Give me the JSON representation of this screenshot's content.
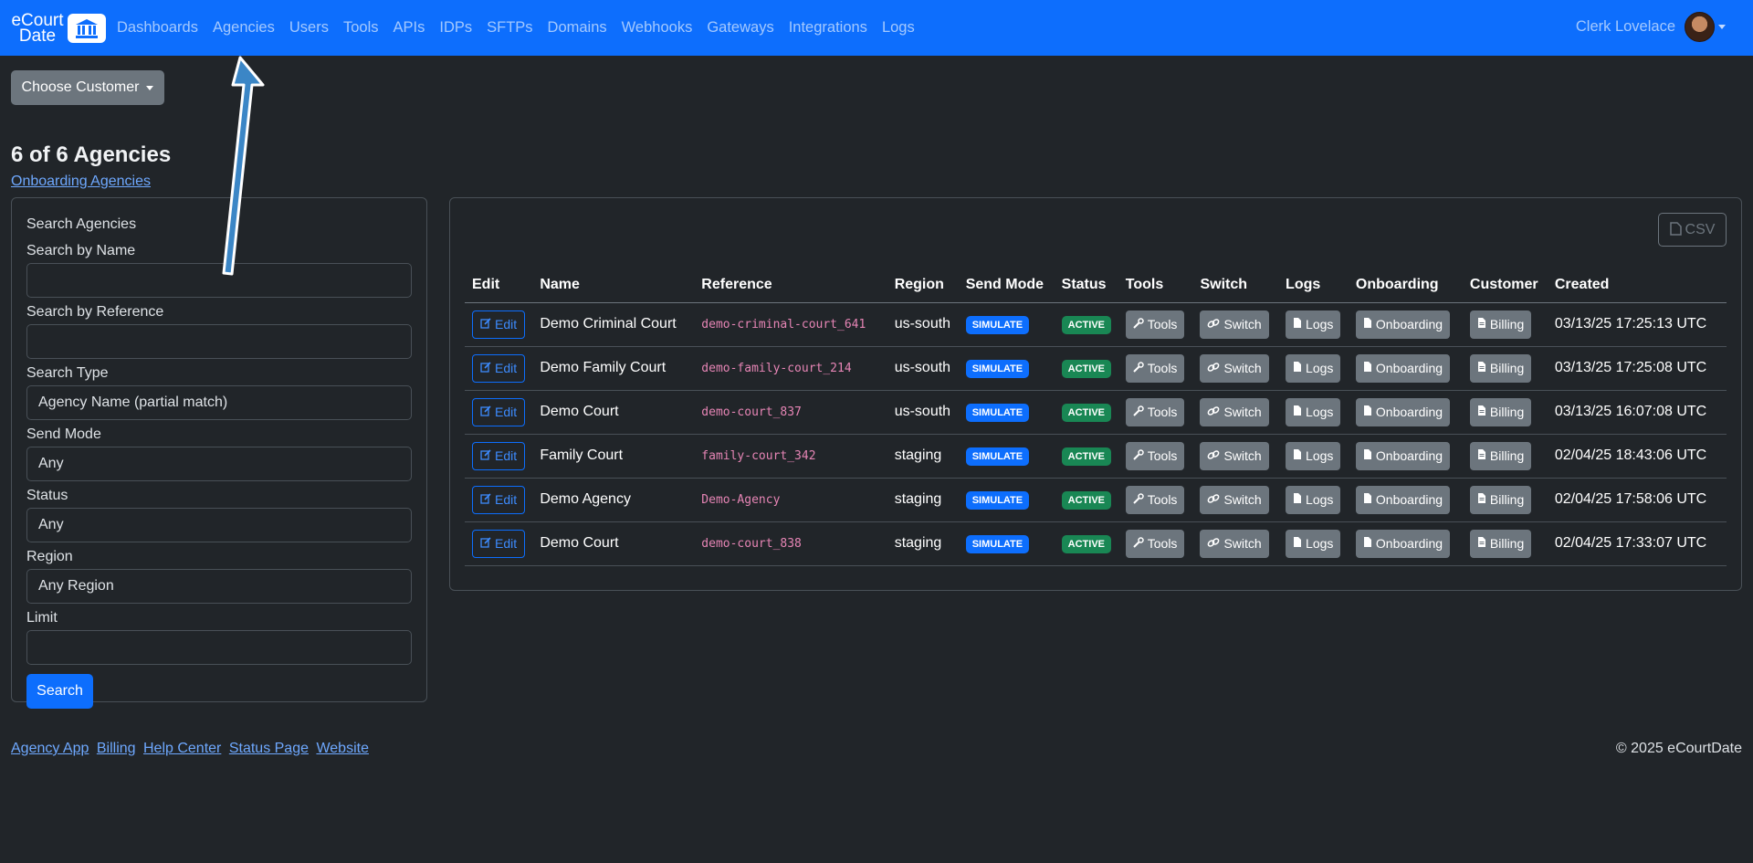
{
  "nav": {
    "brand_line1": "eCourt",
    "brand_line2": "Date",
    "links": [
      "Dashboards",
      "Agencies",
      "Users",
      "Tools",
      "APIs",
      "IDPs",
      "SFTPs",
      "Domains",
      "Webhooks",
      "Gateways",
      "Integrations",
      "Logs"
    ],
    "user_name": "Clerk Lovelace"
  },
  "customer_button": "Choose Customer",
  "heading": "6 of 6 Agencies",
  "onboarding_link": "Onboarding Agencies",
  "search": {
    "title": "Search Agencies",
    "name_label": "Search by Name",
    "name_value": "",
    "reference_label": "Search by Reference",
    "reference_value": "",
    "type_label": "Search Type",
    "type_value": "Agency Name (partial match)",
    "send_mode_label": "Send Mode",
    "send_mode_value": "Any",
    "status_label": "Status",
    "status_value": "Any",
    "region_label": "Region",
    "region_value": "Any Region",
    "limit_label": "Limit",
    "limit_value": "",
    "button": "Search"
  },
  "table": {
    "csv_label": "CSV",
    "headers": [
      "Edit",
      "Name",
      "Reference",
      "Region",
      "Send Mode",
      "Status",
      "Tools",
      "Switch",
      "Logs",
      "Onboarding",
      "Customer",
      "Created"
    ],
    "button_labels": {
      "edit": "Edit",
      "tools": "Tools",
      "switch": "Switch",
      "logs": "Logs",
      "onboarding": "Onboarding",
      "billing": "Billing"
    },
    "rows": [
      {
        "name": "Demo Criminal Court",
        "reference": "demo-criminal-court_641",
        "region": "us-south",
        "send_mode": "SIMULATE",
        "status": "ACTIVE",
        "created": "03/13/25 17:25:13 UTC"
      },
      {
        "name": "Demo Family Court",
        "reference": "demo-family-court_214",
        "region": "us-south",
        "send_mode": "SIMULATE",
        "status": "ACTIVE",
        "created": "03/13/25 17:25:08 UTC"
      },
      {
        "name": "Demo Court",
        "reference": "demo-court_837",
        "region": "us-south",
        "send_mode": "SIMULATE",
        "status": "ACTIVE",
        "created": "03/13/25 16:07:08 UTC"
      },
      {
        "name": "Family Court",
        "reference": "family-court_342",
        "region": "staging",
        "send_mode": "SIMULATE",
        "status": "ACTIVE",
        "created": "02/04/25 18:43:06 UTC"
      },
      {
        "name": "Demo Agency",
        "reference": "Demo-Agency",
        "region": "staging",
        "send_mode": "SIMULATE",
        "status": "ACTIVE",
        "created": "02/04/25 17:58:06 UTC"
      },
      {
        "name": "Demo Court",
        "reference": "demo-court_838",
        "region": "staging",
        "send_mode": "SIMULATE",
        "status": "ACTIVE",
        "created": "02/04/25 17:33:07 UTC"
      }
    ]
  },
  "footer": {
    "links": [
      "Agency App",
      "Billing",
      "Help Center",
      "Status Page",
      "Website"
    ],
    "copyright": "© 2025 eCourtDate"
  },
  "colors": {
    "navbar": "#0d6efd",
    "background": "#212529",
    "simulate_badge": "#0d6efd",
    "active_badge": "#198754",
    "reference_text": "#e685b5",
    "arrow": "#3b86c6"
  },
  "icons": {
    "logo": "courthouse-icon",
    "edit": "edit-icon",
    "tools": "wrench-icon",
    "switch": "link-icon",
    "logs": "file-icon",
    "onboarding": "file-icon",
    "billing": "invoice-icon",
    "csv": "csv-file-icon",
    "annotation": "arrow-up-icon"
  }
}
